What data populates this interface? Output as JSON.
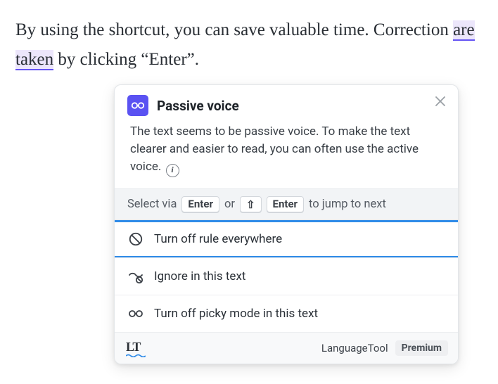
{
  "document": {
    "text_pre": "By using the shortcut, you can save valuable time. Correction ",
    "flagged": "are taken",
    "text_post": " by clicking “Enter”."
  },
  "popup": {
    "rule_title": "Passive voice",
    "explanation": "The text seems to be passive voice. To make the text clearer and easier to read, you can often use the active voice.",
    "shortcut": {
      "prefix": "Select via",
      "key1": "Enter",
      "or": "or",
      "key_shift_glyph": "⇧",
      "key2": "Enter",
      "suffix": "to jump to next"
    },
    "options": {
      "turn_off_rule": "Turn off rule everywhere",
      "ignore_text": "Ignore in this text",
      "turn_off_picky": "Turn off picky mode in this text"
    },
    "footer": {
      "logo_text": "LT",
      "brand_name": "LanguageTool",
      "premium_label": "Premium"
    }
  }
}
